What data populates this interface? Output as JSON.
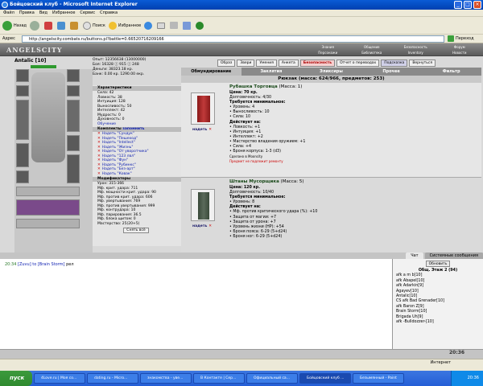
{
  "window": {
    "title": "Бойцовский клуб - Microsoft Internet Explorer"
  },
  "menu": [
    "Файл",
    "Правка",
    "Вид",
    "Избранное",
    "Сервис",
    "Справка"
  ],
  "toolbar": {
    "back": "Назад",
    "search": "Поиск",
    "favorites": "Избранное"
  },
  "address": {
    "label": "Адрес",
    "url": "http://angelscity.combats.ru/buttons.pl?battle=0.66520716209166",
    "go": "Переход"
  },
  "game": {
    "logo": "ANGELSCITY",
    "top_links": [
      "Знания",
      "Общение",
      "Безопасность",
      "Форум",
      "Персонажи",
      "Библиотека",
      "Inventory",
      "Новости"
    ],
    "character": {
      "name": "Antalic [10]"
    },
    "stats": {
      "exp": "Опыт: 12356638 (13000000)",
      "wins": "Боя: 16328 ⓘ 915 ⓘ 248",
      "money": "Деньги: 38323.18 кр.",
      "bank": "Банк: 0.00 кр. 1290.00 екр."
    },
    "sections": {
      "characteristics": "Характеристики",
      "mods": "Модификаторы",
      "kmpl": "Комплекты",
      "remember": "запомнить",
      "learning": "Обучение",
      "take_off": "Снять всё"
    },
    "char_stats": [
      "Сила: 42",
      "Ловкость: 38",
      "Интуиция: 128",
      "Выносливость: 50",
      "Интеллект: 42",
      "Мудрость: 0",
      "Духовность: 0"
    ],
    "sets": [
      "Надеть \"Сундук\"",
      "Надеть \"Пешеход\"",
      "Надеть \"Intellect\"",
      "Надеть \"Жизнь\"",
      "Надеть \"От уворотчика\"",
      "Надеть \"123 лвл\"",
      "Надеть \"Фун\"",
      "Надеть \"Рубинкс\"",
      "Надеть \"Без-арт\"",
      "Надеть \"Ковак\""
    ],
    "mods_list": [
      "Урон: 315-366",
      "Мф. крит. удара: 711",
      "Мф. мощности крит. удара: 90",
      "Мф. против крит. удара: 606",
      "Мф. увертывания: 769",
      "Мф. против увертывания: 999",
      "Мф. контрудара: 10",
      "Мф. парирования: 36.5",
      "Мф. блока щитом: 0",
      "Мастерство: 25(20+5)"
    ]
  },
  "actions": [
    "Образ",
    "Звери",
    "Умения",
    "Анкета",
    "Безопасность",
    "Отчет о переводах",
    "Подсказка",
    "Вернуться"
  ],
  "tabs": [
    "Обмундирование",
    "Заклятия",
    "Эликсиры",
    "Прочее",
    "Фильтр"
  ],
  "backpack": "Рюкзак (масса: 624/966, предметов: 253)",
  "items": [
    {
      "name": "Рубашка Торговца",
      "mass": "(Масса: 1)",
      "wear": "надеть",
      "props": [
        "Цена: 70 кр.",
        "Долговечность: 4/30",
        "Требуется минимальное:",
        "• Уровень: 4",
        "• Выносливость: 10",
        "• Сила: 10",
        "Действует на:",
        "• Ловкость: +1",
        "• Интуиция: +1",
        "• Интеллект: +2",
        "• Мастерство владения оружием: +1",
        "• Сила: +4",
        "• Броня корпуса: 1-3 (d3)",
        "Сделано в Moonсity",
        "Предмет не подлежит ремонту"
      ]
    },
    {
      "name": "Штаны Мусорщика",
      "mass": "(Масса: 5)",
      "wear": "надеть",
      "props": [
        "Цена: 120 кр.",
        "Долговечность: 10/40",
        "Требуется минимальное:",
        "• Уровень: 8",
        "Действует на:",
        "• Мф. против критического удара (%): +10",
        "• Защита от магии: +7",
        "• Защита от урона: +7",
        "• Уровень жизни (HP): +54",
        "• Броня пояса: 6-29 (5+d24)",
        "• Броня ног: 6-29 (5+d24)"
      ]
    }
  ],
  "chat": {
    "tabs": [
      "Чат",
      "Системные сообщения"
    ],
    "line": {
      "time": "20:34",
      "from": "[Zuvu]",
      "to": "to [Brain Storm]",
      "text": "рел"
    }
  },
  "online": {
    "refresh": "Обновить",
    "header": "Общ. Этаж 2 (94)",
    "users": [
      "afk a m b[10]",
      "afk Abapel[10]",
      "afk Adarkin[9]",
      "Agayev[10]",
      "Antalic[10]",
      "CS afk Bad Grenader[10]",
      "afk Baron Z[9]",
      "Brain Storm[10]",
      "Brigada Uh[9]",
      "afk -Bulldozzer-[10]"
    ]
  },
  "clock": "20:36",
  "status": {
    "left": "",
    "zone": "Интернет"
  },
  "taskbar": {
    "start": "пуск",
    "tasks": [
      "4Love.ru | Моя со...",
      "dating.ru - Micro...",
      "знакомства - уве...",
      "В Контакте | Сер...",
      "Официальный са...",
      "Бойцовский клуб ...",
      "Безымянный - Paint"
    ],
    "active": 5,
    "time": "20:36"
  }
}
